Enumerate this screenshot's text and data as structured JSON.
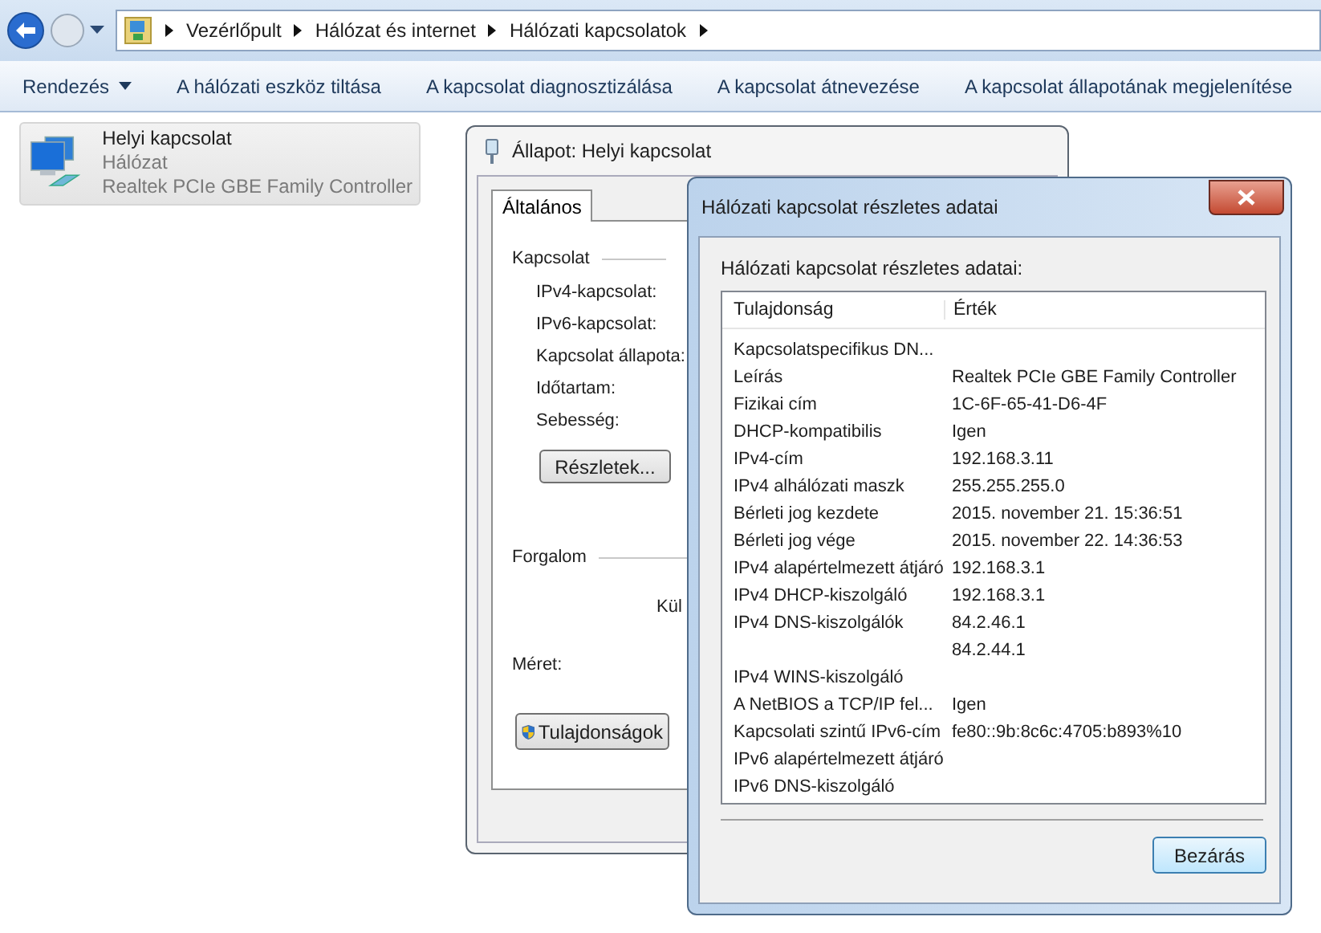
{
  "address_bar": {
    "breadcrumb": [
      "Vezérlőpult",
      "Hálózat és internet",
      "Hálózati kapcsolatok"
    ]
  },
  "toolbar": {
    "items": [
      {
        "label": "Rendezés",
        "kind": "menu"
      },
      {
        "label": "A hálózati eszköz tiltása",
        "kind": "action"
      },
      {
        "label": "A kapcsolat diagnosztizálása",
        "kind": "action"
      },
      {
        "label": "A kapcsolat átnevezése",
        "kind": "action"
      },
      {
        "label": "A kapcsolat állapotának megjelenítése",
        "kind": "action"
      }
    ]
  },
  "connection": {
    "name": "Helyi kapcsolat",
    "network": "Hálózat",
    "adapter": "Realtek PCIe GBE Family Controller"
  },
  "status_window": {
    "title": "Állapot: Helyi kapcsolat",
    "tabs": [
      {
        "label": "Általános",
        "selected": true
      }
    ],
    "connection_section": {
      "heading": "Kapcsolat",
      "labels": [
        "IPv4-kapcsolat:",
        "IPv6-kapcsolat:",
        "Kapcsolat állapota:",
        "Időtartam:",
        "Sebesség:"
      ]
    },
    "details_button": "Részletek...",
    "traffic_section": {
      "heading": "Forgalom",
      "column_1": "Kül"
    },
    "size_label": "Méret:",
    "properties_button": "Tulajdonságok"
  },
  "details_window": {
    "title": "Hálózati kapcsolat részletes adatai",
    "list_label": "Hálózati kapcsolat részletes adatai:",
    "columns": [
      "Tulajdonság",
      "Érték"
    ],
    "rows": [
      {
        "property": "Kapcsolatspecifikus DN..."
      },
      {
        "property": "Leírás",
        "value": "Realtek PCIe GBE Family Controller"
      },
      {
        "property": "Fizikai cím",
        "value": "1C-6F-65-41-D6-4F"
      },
      {
        "property": "DHCP-kompatibilis",
        "value": "Igen"
      },
      {
        "property": "IPv4-cím",
        "value": "192.168.3.11"
      },
      {
        "property": "IPv4 alhálózati maszk",
        "value": "255.255.255.0"
      },
      {
        "property": "Bérleti jog kezdete",
        "value": "2015. november 21. 15:36:51"
      },
      {
        "property": "Bérleti jog vége",
        "value": "2015. november 22. 14:36:53"
      },
      {
        "property": "IPv4 alapértelmezett átjáró",
        "value": "192.168.3.1"
      },
      {
        "property": "IPv4 DHCP-kiszolgáló",
        "value": "192.168.3.1"
      },
      {
        "property": "IPv4 DNS-kiszolgálók",
        "value": "84.2.46.1"
      },
      {
        "value": "84.2.44.1"
      },
      {
        "property": "IPv4 WINS-kiszolgáló"
      },
      {
        "property": "A NetBIOS a TCP/IP fel...",
        "value": "Igen"
      },
      {
        "property": "Kapcsolati szintű IPv6-cím",
        "value": "fe80::9b:8c6c:4705:b893%10"
      },
      {
        "property": "IPv6 alapértelmezett átjáró"
      },
      {
        "property": "IPv6 DNS-kiszolgáló"
      }
    ],
    "close_button": "Bezárás"
  }
}
